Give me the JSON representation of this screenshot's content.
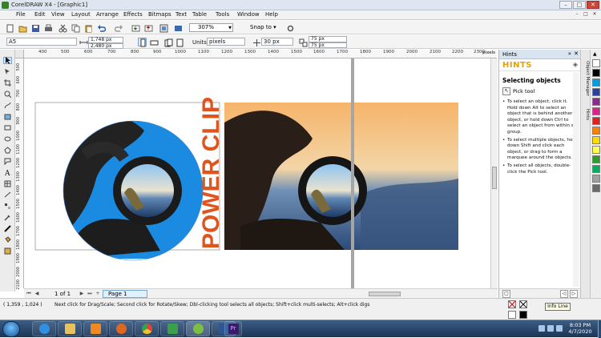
{
  "window": {
    "title": "CorelDRAW X4 - [Graphic1]",
    "buttons": [
      "–",
      "□",
      "✕"
    ]
  },
  "menu": {
    "items": [
      "File",
      "Edit",
      "View",
      "Layout",
      "Arrange",
      "Effects",
      "Bitmaps",
      "Text",
      "Table",
      "Tools",
      "Window",
      "Help"
    ],
    "doc_buttons": [
      "–",
      "□",
      "✕"
    ]
  },
  "toolbar": {
    "zoom": "307%",
    "snap": "Snap to"
  },
  "propbar": {
    "page_size": "A5",
    "width": "1,748 px",
    "height": "2,480 px",
    "units_label": "Units:",
    "units": "pixels",
    "nudge": "30 px",
    "dup_x": "75 px",
    "dup_y": "75 px"
  },
  "ruler": {
    "h_ticks": [
      "400",
      "500",
      "600",
      "700",
      "800",
      "900",
      "1000",
      "1100",
      "1200",
      "1300",
      "1400",
      "1500",
      "1600",
      "1700",
      "1800",
      "1900",
      "2000",
      "2100",
      "2200",
      "2300"
    ],
    "h_unit": "pixels",
    "v_ticks": [
      "500",
      "600",
      "700",
      "800",
      "900",
      "1000",
      "1100",
      "1200",
      "1300",
      "1400",
      "1500",
      "1600",
      "1700",
      "1800",
      "1900",
      "2000",
      "2100"
    ]
  },
  "canvas": {
    "power_clip_text": "POWER CLIP"
  },
  "pagenav": {
    "page_of": "1 of 1",
    "tab": "Page 1"
  },
  "docker": {
    "title": "Hints",
    "hints_label": "HINTS",
    "heading": "Selecting objects",
    "tool_label": "Pick tool",
    "bullets": [
      "To select an object, click it. Hold down Alt to select an object that is behind another object, or hold down Ctrl to select an object from within a group.",
      "To select multiple objects, hold down Shift and click each object, or drag to form a marquee around the objects.",
      "To select all objects, double-click the Pick tool."
    ]
  },
  "side_tabs": [
    "Object Manager",
    "Hints"
  ],
  "palette": {
    "colors": [
      "#ffffff",
      "#000000",
      "#00a0e0",
      "#2a3f9e",
      "#8e2a8e",
      "#e01f8a",
      "#e02020",
      "#ff8000",
      "#ffd800",
      "#ffff50",
      "#2a9d2a",
      "#00b060",
      "#a0a0a0",
      "#6a6a6a"
    ]
  },
  "status": {
    "coords": "( 1,359 , 1,024 )",
    "message": "Next click for Drag/Scale; Second click for Rotate/Skew; Dbl-clicking tool selects all objects; Shift+click multi-selects; Alt+click digs",
    "info_line": "Info Line"
  },
  "taskbar": {
    "time": "8:03 PM",
    "date": "4/7/2020"
  }
}
